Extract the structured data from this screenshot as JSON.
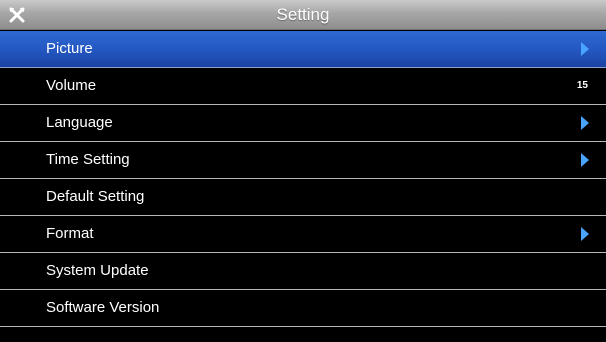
{
  "header": {
    "title": "Setting",
    "icon": "tools-icon"
  },
  "menu": {
    "items": [
      {
        "label": "Picture",
        "value": "",
        "has_arrow": true,
        "selected": true
      },
      {
        "label": "Volume",
        "value": "15",
        "has_arrow": false,
        "selected": false
      },
      {
        "label": "Language",
        "value": "",
        "has_arrow": true,
        "selected": false
      },
      {
        "label": "Time Setting",
        "value": "",
        "has_arrow": true,
        "selected": false
      },
      {
        "label": "Default Setting",
        "value": "",
        "has_arrow": false,
        "selected": false
      },
      {
        "label": "Format",
        "value": "",
        "has_arrow": true,
        "selected": false
      },
      {
        "label": "System Update",
        "value": "",
        "has_arrow": false,
        "selected": false
      },
      {
        "label": "Software Version",
        "value": "",
        "has_arrow": false,
        "selected": false
      }
    ]
  },
  "colors": {
    "selected_background": "#2458c3",
    "arrow": "#4aa3ff",
    "text": "#ffffff",
    "divider": "#b8b8b8"
  }
}
